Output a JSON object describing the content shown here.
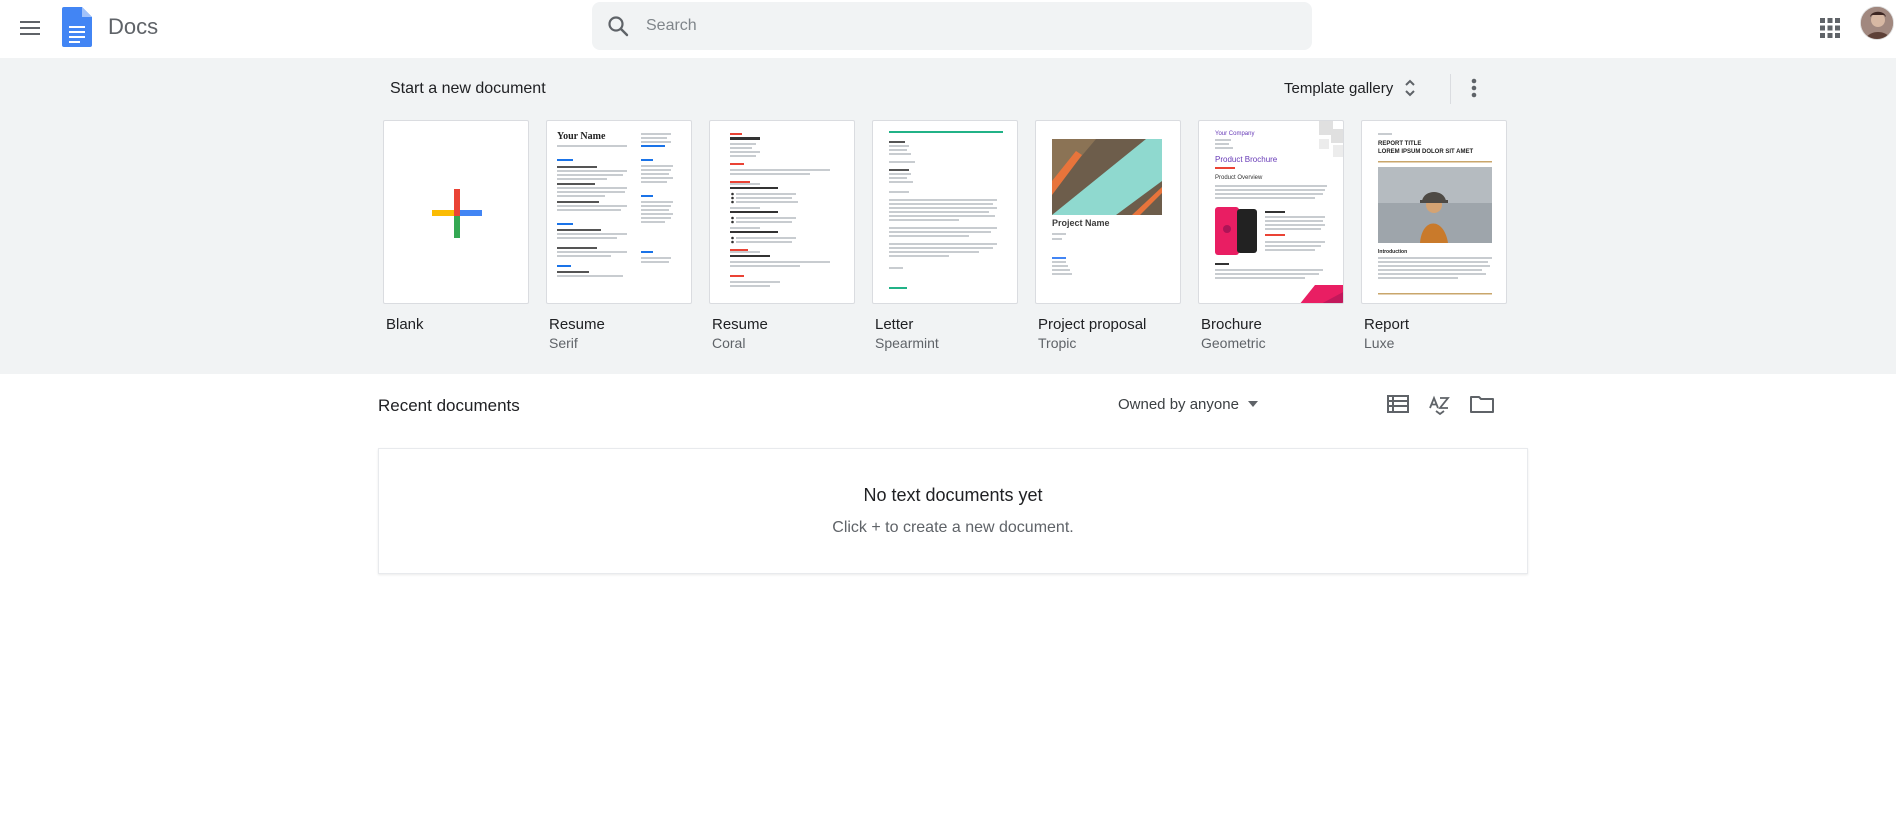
{
  "header": {
    "app_title": "Docs",
    "search_placeholder": "Search"
  },
  "templates": {
    "section_title": "Start a new document",
    "gallery_label": "Template gallery",
    "items": [
      {
        "name": "Blank",
        "subtitle": ""
      },
      {
        "name": "Resume",
        "subtitle": "Serif"
      },
      {
        "name": "Resume",
        "subtitle": "Coral"
      },
      {
        "name": "Letter",
        "subtitle": "Spearmint"
      },
      {
        "name": "Project proposal",
        "subtitle": "Tropic"
      },
      {
        "name": "Brochure",
        "subtitle": "Geometric"
      },
      {
        "name": "Report",
        "subtitle": "Luxe"
      }
    ],
    "thumb_text": {
      "serif_name": "Your Name",
      "proposal_title": "Project Name",
      "brochure_company": "Your Company",
      "brochure_title": "Product Brochure",
      "brochure_overview": "Product Overview",
      "report_heading": "REPORT TITLE",
      "report_sub": "LOREM IPSUM DOLOR SIT AMET",
      "report_intro": "Introduction"
    }
  },
  "recent": {
    "title": "Recent documents",
    "owner_filter": "Owned by anyone",
    "empty_title": "No text documents yet",
    "empty_subtitle": "Click + to create a new document."
  },
  "colors": {
    "docs_blue": "#4285f4",
    "plus_red": "#ea4335",
    "plus_blue": "#4285f4",
    "plus_green": "#34a853",
    "plus_yellow": "#fbbc04",
    "tropic_teal": "#8fd9cf",
    "geometric_pink": "#e91e63"
  }
}
